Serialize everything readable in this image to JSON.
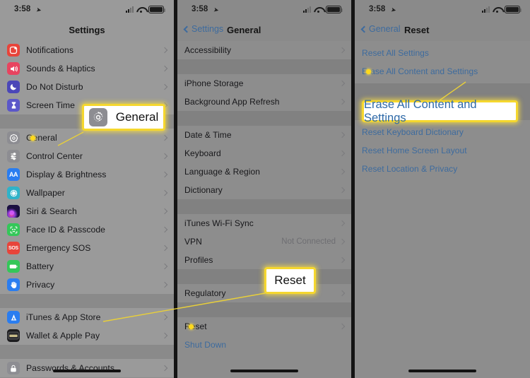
{
  "status": {
    "time": "3:58",
    "location_icon": "location-arrow-icon",
    "wifi_icon": "wifi-icon",
    "battery_icon": "battery-icon",
    "cellular_icon": "cellular-bars-icon"
  },
  "panel1": {
    "nav": {
      "title": "Settings"
    },
    "groups": [
      {
        "rows": [
          {
            "label": "Notifications",
            "icon": "notifications-icon",
            "color": "#e8443a",
            "chevron": true
          },
          {
            "label": "Sounds & Haptics",
            "icon": "sounds-haptics-icon",
            "color": "#e8445f",
            "chevron": true
          },
          {
            "label": "Do Not Disturb",
            "icon": "do-not-disturb-icon",
            "color": "#4b47b8",
            "chevron": true
          },
          {
            "label": "Screen Time",
            "icon": "screen-time-icon",
            "color": "#5b57c9",
            "chevron": true
          }
        ]
      },
      {
        "rows": [
          {
            "label": "General",
            "icon": "general-gear-icon",
            "color": "#8d8d92",
            "chevron": true,
            "dot": true
          },
          {
            "label": "Control Center",
            "icon": "control-center-icon",
            "color": "#8d8d92",
            "chevron": true
          },
          {
            "label": "Display & Brightness",
            "icon": "display-brightness-icon",
            "color": "#2a7df0",
            "chevron": true
          },
          {
            "label": "Wallpaper",
            "icon": "wallpaper-icon",
            "color": "#2fb3c9",
            "chevron": true
          },
          {
            "label": "Siri & Search",
            "icon": "siri-search-icon",
            "color": "#33216b",
            "chevron": true
          },
          {
            "label": "Face ID & Passcode",
            "icon": "face-id-passcode-icon",
            "color": "#34c759",
            "chevron": true
          },
          {
            "label": "Emergency SOS",
            "icon": "emergency-sos-icon",
            "color": "#e8443a",
            "chevron": true
          },
          {
            "label": "Battery",
            "icon": "battery-settings-icon",
            "color": "#34c759",
            "chevron": true
          },
          {
            "label": "Privacy",
            "icon": "privacy-hand-icon",
            "color": "#2a7df0",
            "chevron": true
          }
        ]
      },
      {
        "rows": [
          {
            "label": "iTunes & App Store",
            "icon": "app-store-icon",
            "color": "#2a7df0",
            "chevron": true
          },
          {
            "label": "Wallet & Apple Pay",
            "icon": "wallet-apple-pay-icon",
            "color": "#1c1c1e",
            "chevron": true
          }
        ]
      },
      {
        "rows": [
          {
            "label": "Passwords & Accounts",
            "icon": "passwords-accounts-icon",
            "color": "#8d8d92",
            "chevron": true
          }
        ]
      }
    ]
  },
  "panel2": {
    "nav": {
      "back": "Settings",
      "title": "General"
    },
    "groups": [
      {
        "rows": [
          {
            "label": "Accessibility",
            "chevron": true
          }
        ]
      },
      {
        "rows": [
          {
            "label": "iPhone Storage",
            "chevron": true
          },
          {
            "label": "Background App Refresh",
            "chevron": true
          }
        ]
      },
      {
        "rows": [
          {
            "label": "Date & Time",
            "chevron": true
          },
          {
            "label": "Keyboard",
            "chevron": true
          },
          {
            "label": "Language & Region",
            "chevron": true
          },
          {
            "label": "Dictionary",
            "chevron": true
          }
        ]
      },
      {
        "rows": [
          {
            "label": "iTunes Wi-Fi Sync",
            "chevron": true
          },
          {
            "label": "VPN",
            "value": "Not Connected",
            "chevron": true
          },
          {
            "label": "Profiles",
            "chevron": true
          }
        ]
      },
      {
        "rows": [
          {
            "label": "Regulatory",
            "chevron": true
          }
        ]
      },
      {
        "rows": [
          {
            "label": "Reset",
            "chevron": true,
            "dot": true
          },
          {
            "label": "Shut Down",
            "blue": true,
            "chevron": false
          }
        ]
      }
    ]
  },
  "panel3": {
    "nav": {
      "back": "General",
      "title": "Reset"
    },
    "groups": [
      {
        "rows": [
          {
            "label": "Reset All Settings",
            "blue": true
          },
          {
            "label": "Erase All Content and Settings",
            "blue": true,
            "dot": true
          }
        ]
      },
      {
        "rows": [
          {
            "label": "Reset Keyboard Dictionary",
            "blue": true
          },
          {
            "label": "Reset Home Screen Layout",
            "blue": true
          },
          {
            "label": "Reset Location & Privacy",
            "blue": true
          }
        ]
      }
    ]
  },
  "callouts": {
    "general": {
      "text": "General",
      "icon": "general-gear-icon"
    },
    "reset": {
      "text": "Reset"
    },
    "erase": {
      "text": "Erase All Content and Settings"
    }
  },
  "colors": {
    "highlight_border": "#f5d72e",
    "dot": "#ffd91c",
    "link_blue": "#3d6b9e",
    "callout_blue": "#2f6aa8"
  }
}
